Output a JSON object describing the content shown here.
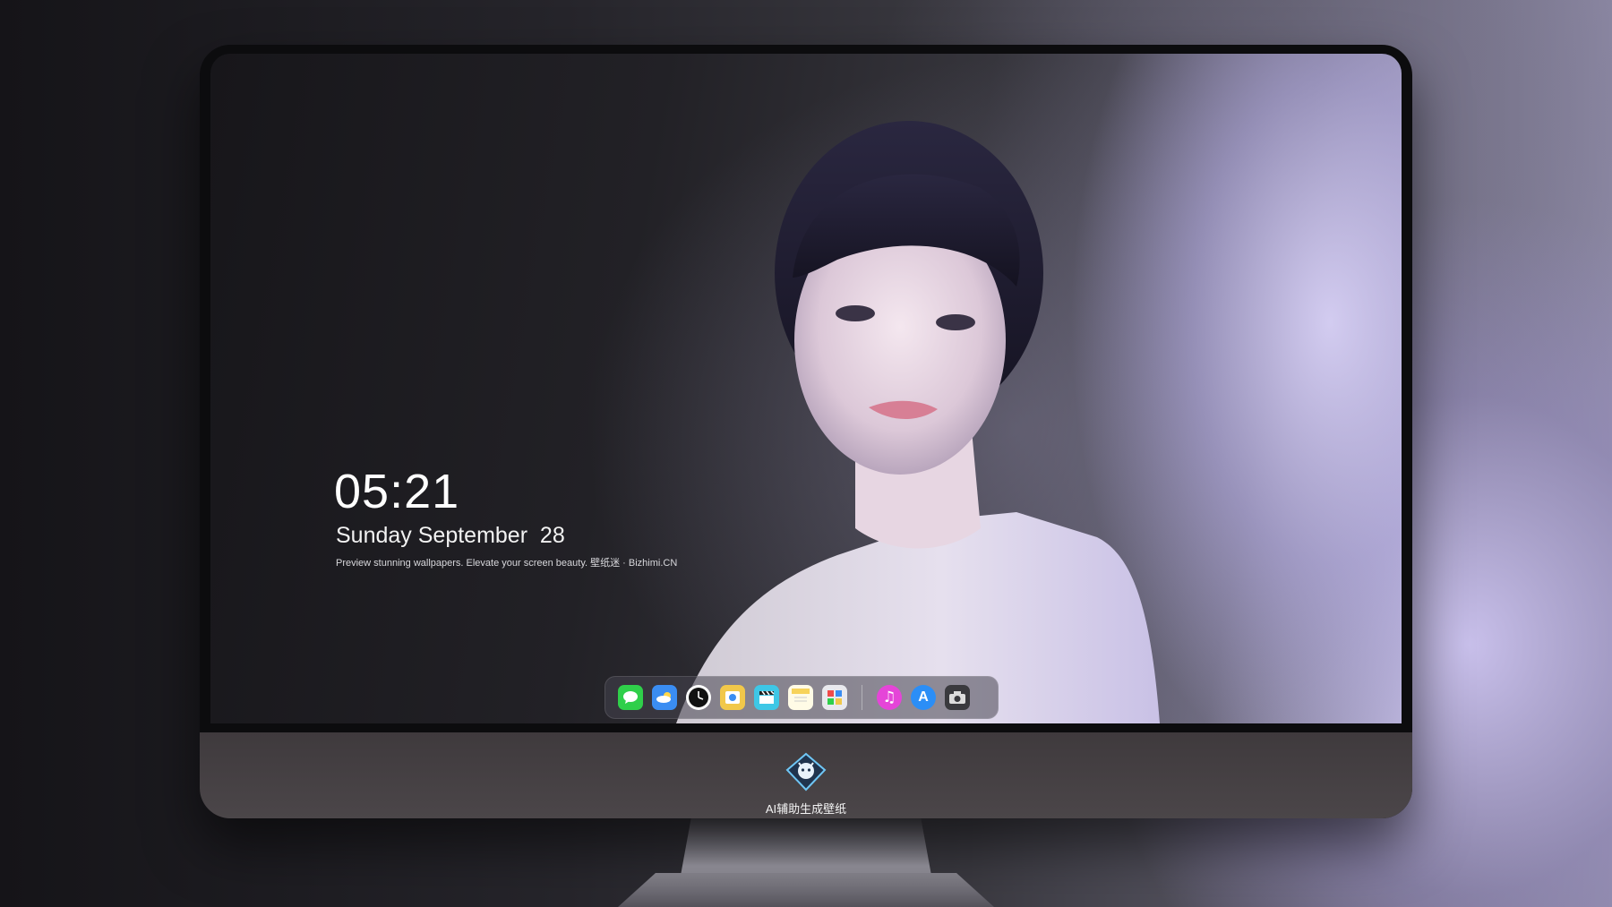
{
  "lockscreen": {
    "time": "05:21",
    "date": "Sunday September  28",
    "tagline": "Preview stunning wallpapers. Elevate your screen beauty. 壁纸迷 · Bizhimi.CN"
  },
  "dock": {
    "apps": [
      {
        "name": "messages-icon",
        "color": "#2fcf4a"
      },
      {
        "name": "weather-icon",
        "color": "#3a8df2"
      },
      {
        "name": "clock-icon",
        "color": "#111111"
      },
      {
        "name": "preview-icon",
        "color": "#f1c84a"
      },
      {
        "name": "video-clapper-icon",
        "color": "#3ec7e6"
      },
      {
        "name": "notes-icon",
        "color": "#f7d35a"
      },
      {
        "name": "photo-editor-icon",
        "color": "#e9e9ee"
      },
      {
        "name": "music-icon",
        "color": "#e545d8"
      },
      {
        "name": "app-store-icon",
        "color": "#2b8ef6"
      },
      {
        "name": "camera-icon",
        "color": "#3a3a3e"
      }
    ]
  },
  "brand": {
    "label": "AI辅助生成壁纸"
  }
}
